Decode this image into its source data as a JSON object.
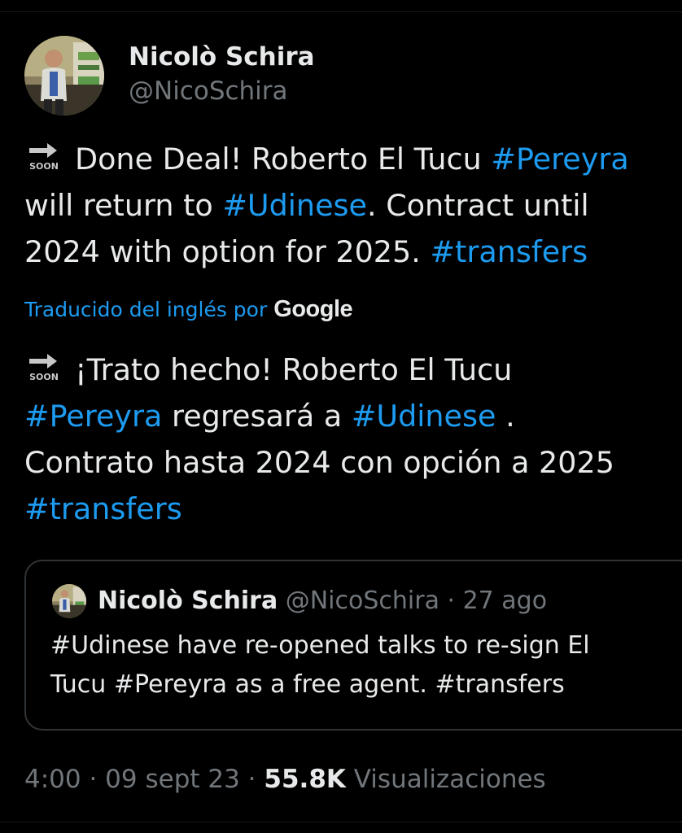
{
  "author": {
    "display_name": "Nicolò Schira",
    "handle": "@NicoSchira",
    "avatar_icon": "profile-photo-icon"
  },
  "tweet": {
    "line1_prefix_emoji": "soon-arrow-icon",
    "line1_text": "Done Deal! Roberto El Tucu ",
    "line1_hashtag": "#Pereyra",
    "line2_text1": "will return to ",
    "line2_hashtag": "#Udinese",
    "line2_text2": ". Contract until",
    "line3_text": "2024 with option for 2025. ",
    "line3_hashtag": "#transfers"
  },
  "translation": {
    "label": "Traducido del inglés por",
    "provider": "Google"
  },
  "translated": {
    "line1_text": "¡Trato hecho! Roberto El Tucu",
    "line2_hashtag1": "#Pereyra",
    "line2_text": " regresará a ",
    "line2_hashtag2": "#Udinese",
    "line2_text2": " .",
    "line3_text": "Contrato hasta 2024 con opción a 2025",
    "line4_hashtag": "#transfers"
  },
  "quote": {
    "name": "Nicolò Schira",
    "handle_date": " @NicoSchira · 27 ago",
    "line1": "#Udinese have re-opened talks to re-sign El",
    "line2": "Tucu #Pereyra as a free agent. #transfers"
  },
  "meta": {
    "time_date": "4:00 · 09 sept 23 · ",
    "views_count": "55.8K",
    "views_label": " Visualizaciones"
  },
  "colors": {
    "background": "#000000",
    "text_primary": "#e7e9ea",
    "text_secondary": "#71767b",
    "accent": "#1d9bf0",
    "border": "#2f3336"
  }
}
